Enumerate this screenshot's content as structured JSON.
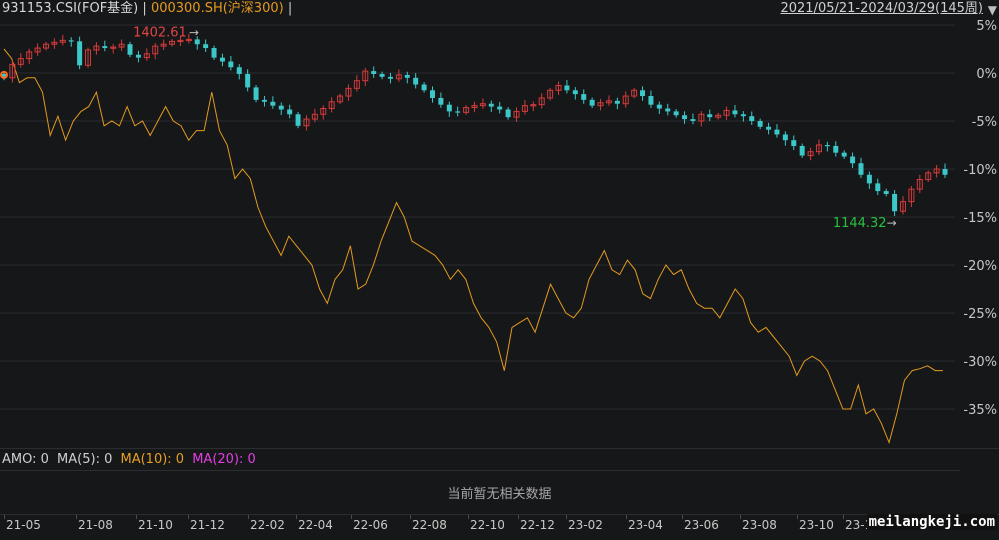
{
  "header": {
    "index_label": "931153.CSI(FOF基金)",
    "separator": "|",
    "compare_label": "000300.SH(沪深300)",
    "range_label": "2021/05/21-2024/03/29(145周)",
    "index_color": "#d8d8d8",
    "compare_color": "#e69a1e",
    "dropdown_icon": "triangle-down-icon"
  },
  "colors": {
    "up": "#d43b3b",
    "down": "#3cc8c8",
    "line": "#e39a20",
    "high_label": "#e14545",
    "low_label": "#27c23e",
    "grid": "#2a2b2e"
  },
  "chart_data": {
    "type": "candlestick",
    "x_ticks": [
      "21-05",
      "21-08",
      "21-10",
      "21-12",
      "22-02",
      "22-04",
      "22-06",
      "22-08",
      "22-10",
      "22-12",
      "23-02",
      "23-04",
      "23-06",
      "23-08",
      "23-10",
      "23-1"
    ],
    "y_ticks": [
      "5%",
      "0%",
      "-5%",
      "-10%",
      "-15%",
      "-20%",
      "-25%",
      "-30%",
      "-35%"
    ],
    "ylim": [
      -39.5,
      6
    ],
    "annotations": {
      "high": "1402.61",
      "low": "1144.32"
    },
    "fof_close_pct": [
      -0.5,
      0.9,
      1.5,
      2.2,
      2.6,
      3.0,
      3.2,
      3.4,
      3.3,
      0.8,
      2.4,
      2.8,
      2.6,
      2.7,
      3.0,
      1.9,
      1.6,
      2.0,
      2.8,
      3.0,
      3.3,
      3.4,
      3.5,
      3.0,
      2.6,
      1.6,
      1.2,
      0.6,
      -0.1,
      -1.5,
      -2.8,
      -3.0,
      -3.4,
      -3.8,
      -4.3,
      -5.5,
      -4.8,
      -4.3,
      -3.7,
      -3.0,
      -2.4,
      -1.6,
      -0.8,
      0.2,
      -0.1,
      -0.4,
      -0.6,
      -0.2,
      -0.5,
      -1.2,
      -1.8,
      -2.6,
      -3.3,
      -4.0,
      -4.1,
      -3.6,
      -3.4,
      -3.2,
      -3.5,
      -3.8,
      -4.6,
      -4.0,
      -3.4,
      -3.3,
      -2.6,
      -1.8,
      -1.3,
      -1.8,
      -2.2,
      -2.8,
      -3.4,
      -3.1,
      -2.9,
      -3.2,
      -2.4,
      -1.8,
      -2.4,
      -3.3,
      -3.7,
      -4.0,
      -4.4,
      -4.8,
      -5.0,
      -4.3,
      -4.6,
      -4.4,
      -3.9,
      -4.3,
      -4.5,
      -5.0,
      -5.6,
      -5.9,
      -6.4,
      -7.0,
      -7.6,
      -8.6,
      -8.2,
      -7.5,
      -7.6,
      -8.3,
      -8.7,
      -9.4,
      -10.6,
      -11.5,
      -12.3,
      -12.6,
      -14.4,
      -13.4,
      -12.1,
      -11.1,
      -10.4,
      -10.0,
      -10.6
    ],
    "hs300_pct": [
      2.5,
      1.5,
      -1.0,
      -0.5,
      -0.5,
      -2.0,
      -6.5,
      -4.5,
      -7.0,
      -5.0,
      -4.0,
      -3.5,
      -2.0,
      -5.5,
      -5.0,
      -5.5,
      -3.5,
      -5.5,
      -5.0,
      -6.5,
      -5.0,
      -3.5,
      -5.0,
      -5.5,
      -7.0,
      -6.0,
      -6.0,
      -2.0,
      -6.0,
      -7.5,
      -11.0,
      -10.0,
      -11.0,
      -14.0,
      -16.0,
      -17.5,
      -19.0,
      -17.0,
      -18.0,
      -19.0,
      -20.0,
      -22.5,
      -24.0,
      -21.5,
      -20.5,
      -18.0,
      -22.5,
      -22.0,
      -20.0,
      -17.5,
      -15.5,
      -13.5,
      -15.0,
      -17.5,
      -18.0,
      -18.5,
      -19.0,
      -20.0,
      -21.5,
      -20.5,
      -21.5,
      -24.0,
      -25.5,
      -26.5,
      -28.0,
      -31.0,
      -26.5,
      -26.0,
      -25.5,
      -27.0,
      -24.5,
      -22.0,
      -23.5,
      -25.0,
      -25.5,
      -24.5,
      -21.5,
      -20.0,
      -18.5,
      -20.5,
      -21.0,
      -19.5,
      -20.5,
      -23.0,
      -23.5,
      -21.5,
      -20.0,
      -21.0,
      -20.5,
      -22.5,
      -24.0,
      -24.5,
      -24.5,
      -25.5,
      -24.0,
      -22.5,
      -23.5,
      -26.0,
      -27.0,
      -26.5,
      -27.5,
      -28.5,
      -29.5,
      -31.5,
      -30.0,
      -29.5,
      -30.0,
      -31.0,
      -33.0,
      -35.0,
      -35.0,
      -32.5,
      -35.5,
      -35.0,
      -36.5,
      -38.5,
      -35.5,
      -32.0,
      -31.0,
      -30.8,
      -30.5,
      -31.0,
      -31.0
    ]
  },
  "indicator": {
    "amo": "AMO: 0",
    "ma5": "MA(5): 0",
    "ma10": "MA(10): 0",
    "ma20": "MA(20): 0",
    "ma10_color": "#e6a021",
    "ma20_color": "#e23fe2"
  },
  "no_data_text": "当前暂无相关数据",
  "watermark": "meilangkeji.com"
}
